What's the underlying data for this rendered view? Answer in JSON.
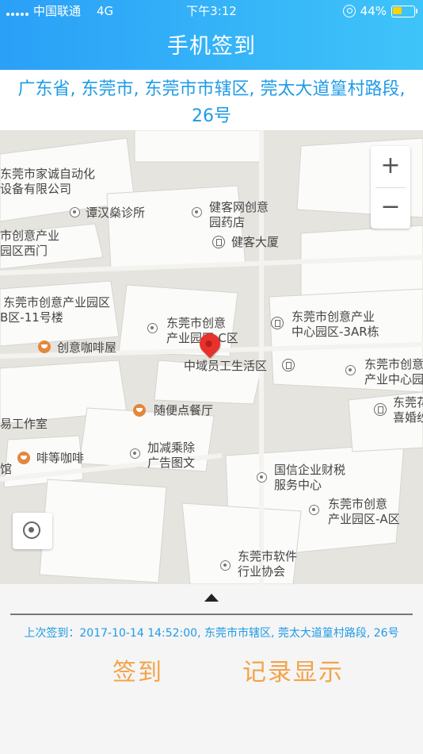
{
  "status_bar": {
    "carrier": "中国联通",
    "network": "4G",
    "time": "下午3:12",
    "battery": "44%",
    "battery_level": 0.44,
    "battery_color": "#ffd200"
  },
  "header": {
    "title": "手机签到",
    "bg_color": "#2aa0f7"
  },
  "address": {
    "text": "广东省, 东莞市, 东莞市市辖区, 莞太大道篁村路段, 26号"
  },
  "map": {
    "zoom_in_label": "+",
    "zoom_out_label": "−",
    "pois": [
      {
        "label": "东莞市家诚自动化"
      },
      {
        "label": "设备有限公司"
      },
      {
        "label": "谭汉燊诊所"
      },
      {
        "label": "健客网创意"
      },
      {
        "label": "园药店"
      },
      {
        "label": "健客大厦"
      },
      {
        "label": "市创意产业"
      },
      {
        "label": "园区西门"
      },
      {
        "label": "东莞市创意产业园区"
      },
      {
        "label": "B区-11号楼"
      },
      {
        "label": "东莞市创意"
      },
      {
        "label": "产业园区-C区"
      },
      {
        "label": "东莞市创意产业"
      },
      {
        "label": "中心园区-3AR栋"
      },
      {
        "label": "创意咖啡屋"
      },
      {
        "label": "中域员工生活区"
      },
      {
        "label": "东莞市创意"
      },
      {
        "label": "产业中心园"
      },
      {
        "label": "东莞花"
      },
      {
        "label": "喜婚纱"
      },
      {
        "label": "随便点餐厅"
      },
      {
        "label": "易工作室"
      },
      {
        "label": "加减乘除"
      },
      {
        "label": "广告图文"
      },
      {
        "label": "啡等咖啡"
      },
      {
        "label": "馆"
      },
      {
        "label": "国信企业财税"
      },
      {
        "label": "服务中心"
      },
      {
        "label": "东莞市创意"
      },
      {
        "label": "产业园区-A区"
      },
      {
        "label": "东莞市软件"
      },
      {
        "label": "行业协会"
      }
    ]
  },
  "panel": {
    "last_signin": "上次签到：2017-10-14 14:52:00, 东莞市市辖区, 莞太大道篁村路段, 26号",
    "signin_button": "签到",
    "records_button": "记录显示",
    "action_color": "#f3a349"
  }
}
